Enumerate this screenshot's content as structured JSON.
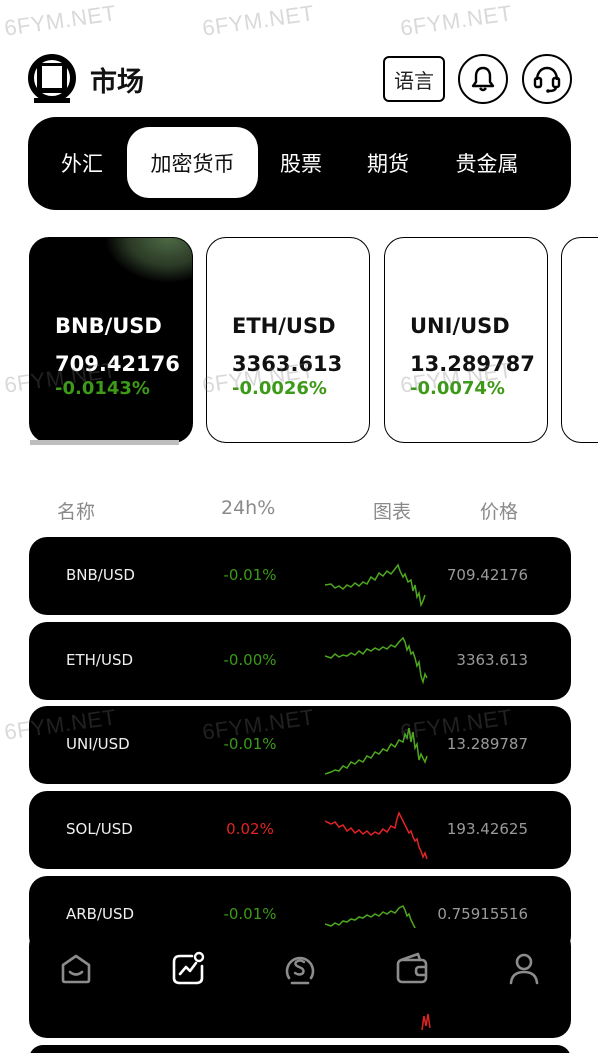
{
  "header": {
    "title": "市场",
    "language_button": "语言"
  },
  "tabs": [
    {
      "label": "外汇",
      "active": false
    },
    {
      "label": "加密货币",
      "active": true
    },
    {
      "label": "股票",
      "active": false
    },
    {
      "label": "期货",
      "active": false
    },
    {
      "label": "贵金属",
      "active": false
    }
  ],
  "cards": [
    {
      "symbol": "BNB/USD",
      "price": "709.42176",
      "change": "-0.0143%"
    },
    {
      "symbol": "ETH/USD",
      "price": "3363.613",
      "change": "-0.0026%"
    },
    {
      "symbol": "UNI/USD",
      "price": "13.289787",
      "change": "-0.0074%"
    }
  ],
  "table": {
    "headers": {
      "name": "名称",
      "change": "24h%",
      "chart": "图表",
      "price": "价格"
    },
    "rows": [
      {
        "symbol": "BNB/USD",
        "change": "-0.01%",
        "price": "709.42176",
        "trend": "up"
      },
      {
        "symbol": "ETH/USD",
        "change": "-0.00%",
        "price": "3363.613",
        "trend": "up"
      },
      {
        "symbol": "UNI/USD",
        "change": "-0.01%",
        "price": "13.289787",
        "trend": "up"
      },
      {
        "symbol": "SOL/USD",
        "change": "0.02%",
        "price": "193.42625",
        "trend": "down"
      },
      {
        "symbol": "ARB/USD",
        "change": "-0.01%",
        "price": "0.75915516",
        "trend": "up"
      }
    ]
  },
  "bottom_nav": [
    {
      "icon": "home-icon",
      "active": false
    },
    {
      "icon": "market-chart-icon",
      "active": true
    },
    {
      "icon": "trade-coin-icon",
      "active": false
    },
    {
      "icon": "wallet-icon",
      "active": false
    },
    {
      "icon": "profile-icon",
      "active": false
    }
  ],
  "watermark": "6FYM.NET",
  "colors": {
    "up": "#3c9a18",
    "down": "#e02424",
    "chart_up": "#4ea81f",
    "chart_down": "#e02424",
    "price_gray": "#9a9a9a"
  }
}
